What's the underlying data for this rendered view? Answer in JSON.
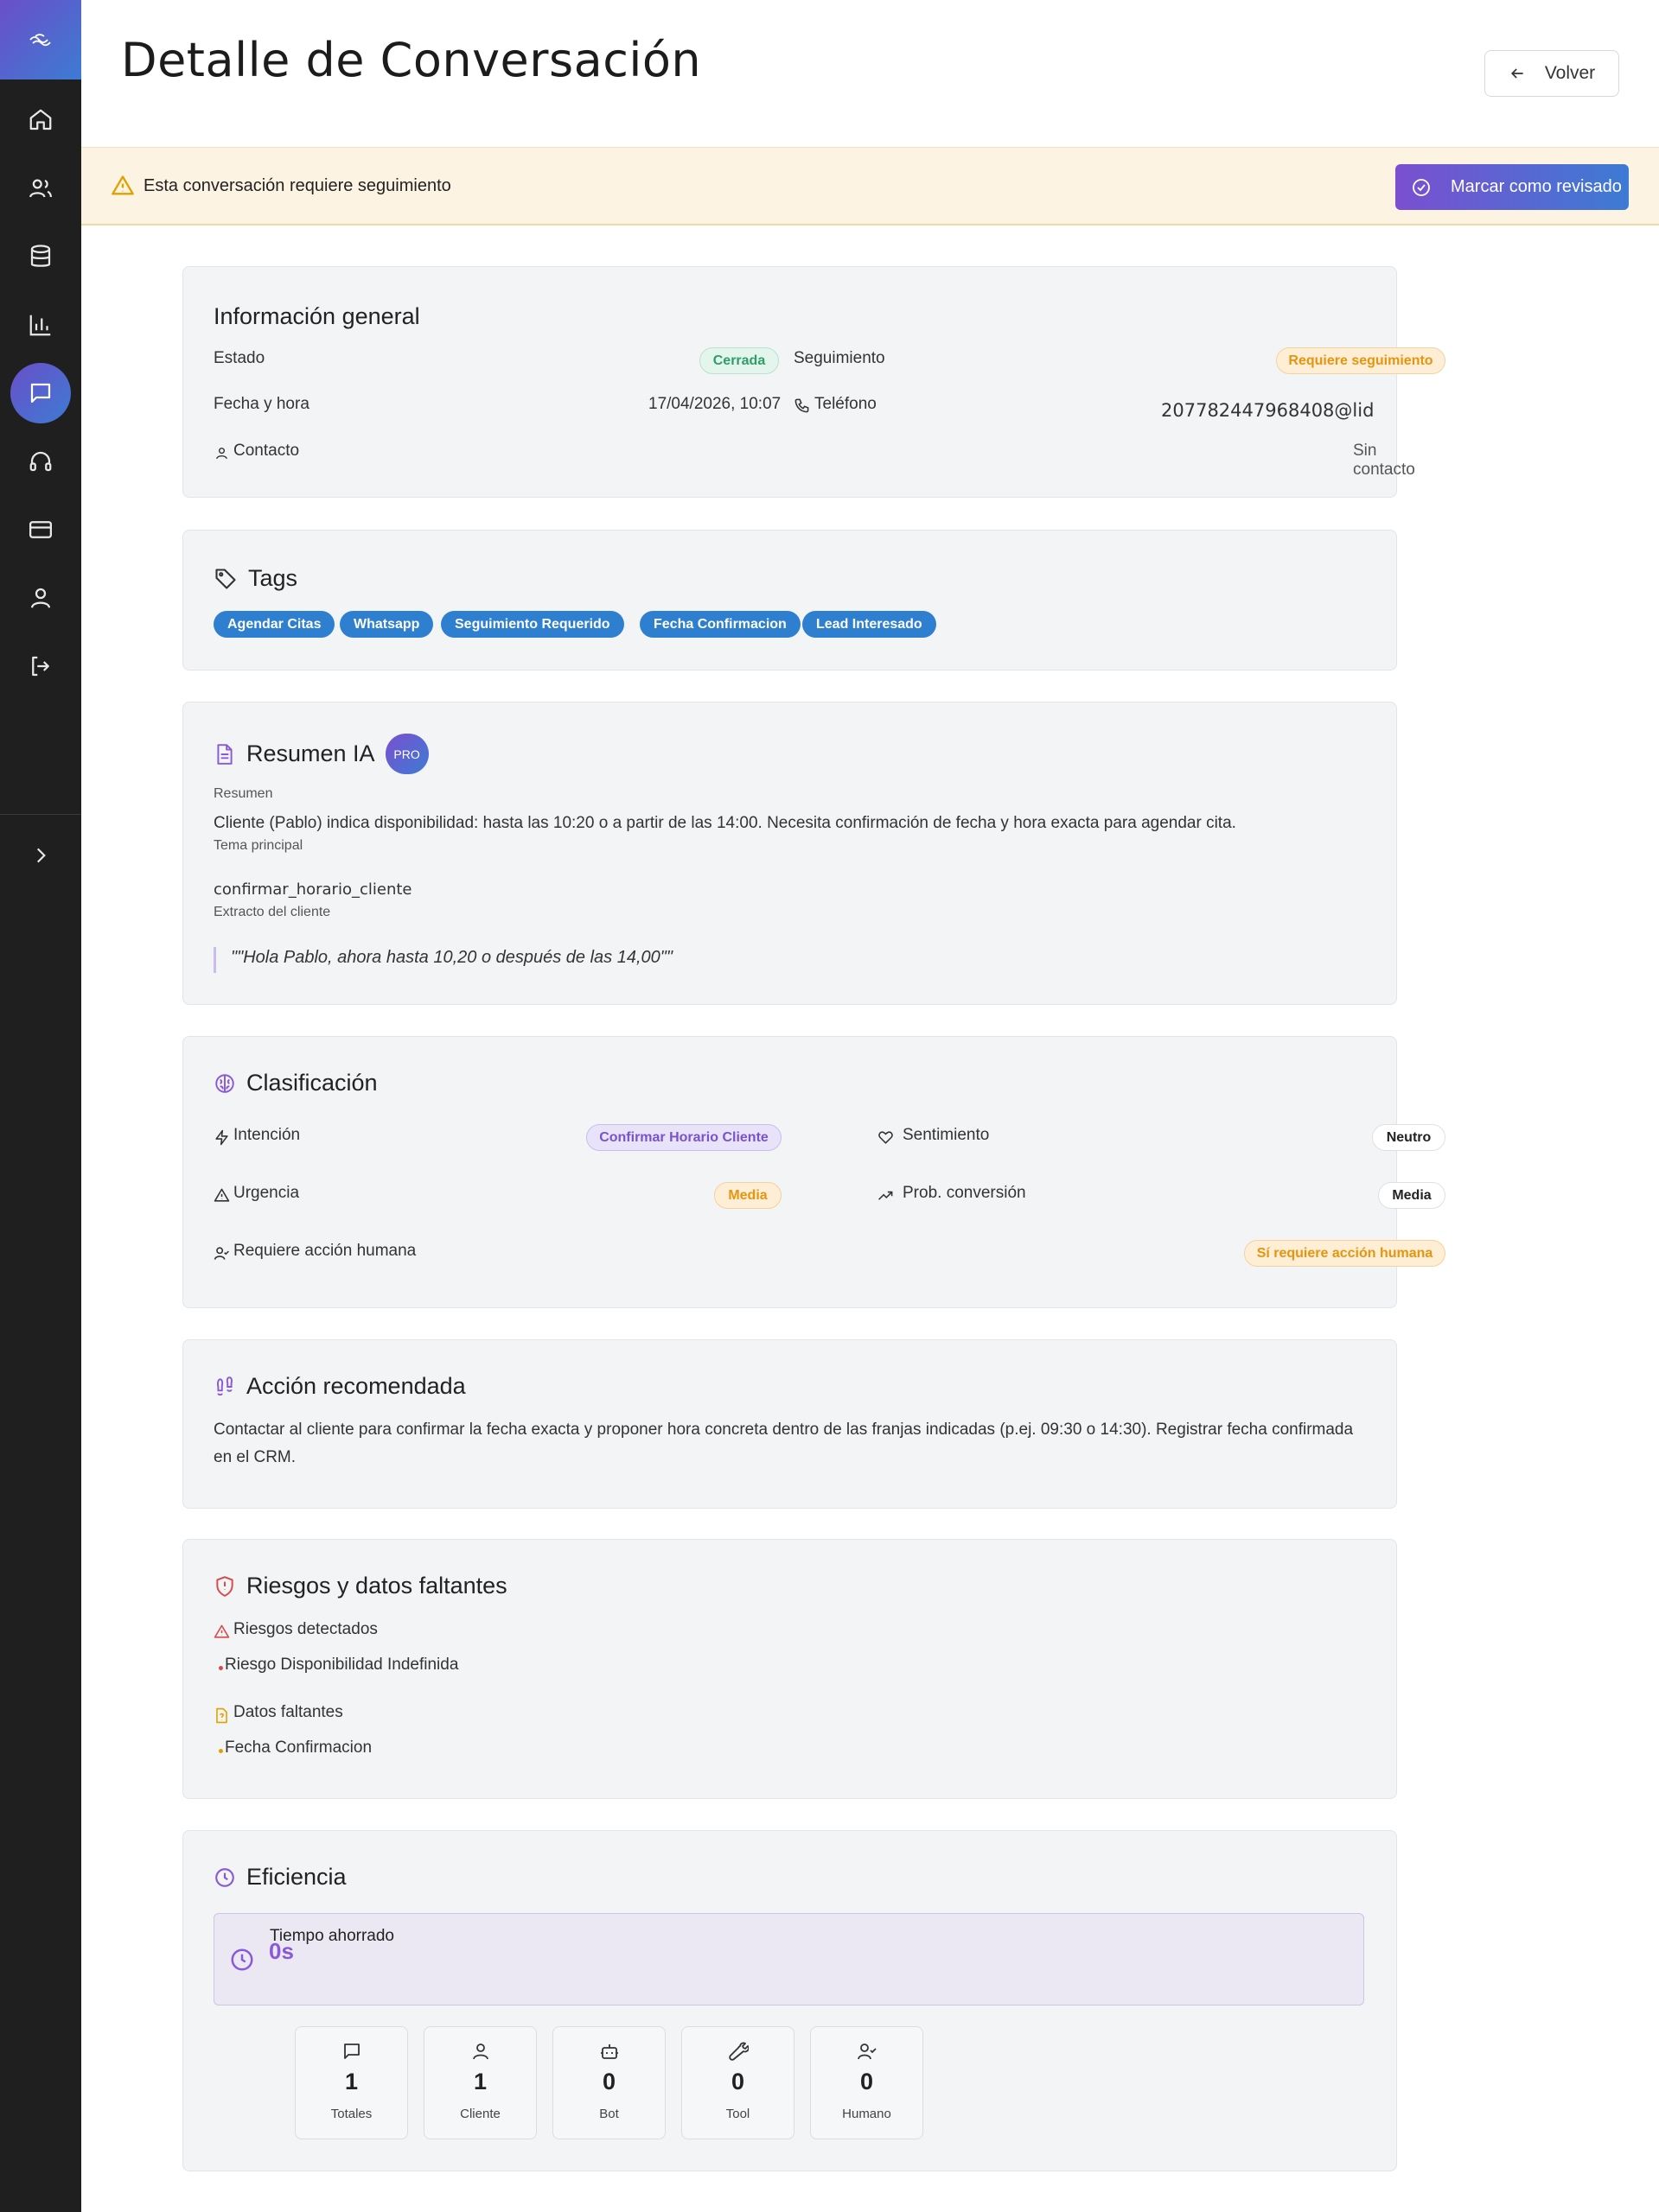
{
  "header": {
    "title": "Detalle de Conversación",
    "back_label": "Volver"
  },
  "banner": {
    "text": "Esta conversación requiere seguimiento",
    "button_label": "Marcar como revisado"
  },
  "sidebar": {
    "items": [
      "home-icon",
      "users-icon",
      "database-icon",
      "chart-icon",
      "chat-icon",
      "headset-icon",
      "card-icon",
      "user-icon",
      "logout-icon"
    ],
    "active": "chat-icon"
  },
  "general": {
    "title": "Información general",
    "estado_label": "Estado",
    "estado_value": "Cerrada",
    "seguimiento_label": "Seguimiento",
    "seguimiento_value": "Requiere seguimiento",
    "fecha_label": "Fecha y hora",
    "fecha_value": "17/04/2026, 10:07",
    "telefono_label": "Teléfono",
    "telefono_value": "207782447968408@lid",
    "contacto_label": "Contacto",
    "contacto_value": "Sin contacto"
  },
  "tags": {
    "title": "Tags",
    "items": [
      "Agendar Citas",
      "Whatsapp",
      "Seguimiento Requerido",
      "Fecha Confirmacion",
      "Lead Interesado"
    ]
  },
  "resumen": {
    "title": "Resumen IA",
    "pro": "PRO",
    "resumen_label": "Resumen",
    "resumen_text": "Cliente (Pablo) indica disponibilidad: hasta las 10:20 o a partir de las 14:00. Necesita confirmación de fecha y hora exacta para agendar cita.",
    "tema_label": "Tema principal",
    "tema_value": "confirmar_horario_cliente",
    "extracto_label": "Extracto del cliente",
    "extracto_value": "\"\"Hola Pablo, ahora hasta 10,20 o después de las 14,00\"\""
  },
  "clasificacion": {
    "title": "Clasificación",
    "intencion_label": "Intención",
    "intencion_value": "Confirmar Horario Cliente",
    "sentimiento_label": "Sentimiento",
    "sentimiento_value": "Neutro",
    "urgencia_label": "Urgencia",
    "urgencia_value": "Media",
    "prob_label": "Prob. conversión",
    "prob_value": "Media",
    "humana_label": "Requiere acción humana",
    "humana_value": "Sí requiere acción humana"
  },
  "accion": {
    "title": "Acción recomendada",
    "text_line1": "Contactar al cliente para confirmar la fecha exacta y proponer hora concreta dentro de las franjas indicadas (p.ej. 09:30 o 14:30). Registrar fecha confirmada",
    "text_line2": "en el CRM."
  },
  "riesgos": {
    "title": "Riesgos y datos faltantes",
    "detectados_label": "Riesgos detectados",
    "detectados_items": [
      "Riesgo Disponibilidad Indefinida"
    ],
    "faltantes_label": "Datos faltantes",
    "faltantes_items": [
      "Fecha Confirmacion"
    ]
  },
  "eficiencia": {
    "title": "Eficiencia",
    "tiempo_label": "Tiempo ahorrado",
    "tiempo_value": "0s",
    "metrics": [
      {
        "value": "1",
        "label": "Totales",
        "icon": "message-icon"
      },
      {
        "value": "1",
        "label": "Cliente",
        "icon": "user-icon"
      },
      {
        "value": "0",
        "label": "Bot",
        "icon": "bot-icon"
      },
      {
        "value": "0",
        "label": "Tool",
        "icon": "wrench-icon"
      },
      {
        "value": "0",
        "label": "Humano",
        "icon": "user-check-icon"
      }
    ]
  }
}
